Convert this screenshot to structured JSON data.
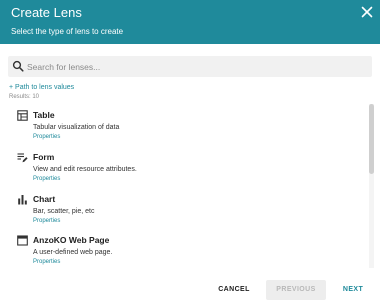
{
  "dialog": {
    "title": "Create Lens",
    "subtitle": "Select the type of lens to create"
  },
  "search": {
    "placeholder": "Search for lenses...",
    "value": ""
  },
  "path_link": "+ Path to lens values",
  "results": "Results: 10",
  "lenses": [
    {
      "title": "Table",
      "description": "Tabular visualization of data",
      "link": "Properties",
      "icon": "table-icon"
    },
    {
      "title": "Form",
      "description": "View and edit resource attributes.",
      "link": "Properties",
      "icon": "form-icon"
    },
    {
      "title": "Chart",
      "description": "Bar, scatter, pie, etc",
      "link": "Properties",
      "icon": "bar-chart-icon"
    },
    {
      "title": "AnzoKO Web Page",
      "description": "A user-defined web page.",
      "link": "Properties",
      "icon": "web-page-icon"
    }
  ],
  "footer": {
    "cancel": "CANCEL",
    "previous": "PREVIOUS",
    "next": "NEXT"
  },
  "colors": {
    "accent": "#1f8a9b",
    "header_text": "#ffffff",
    "disabled_bg": "#ededed"
  }
}
